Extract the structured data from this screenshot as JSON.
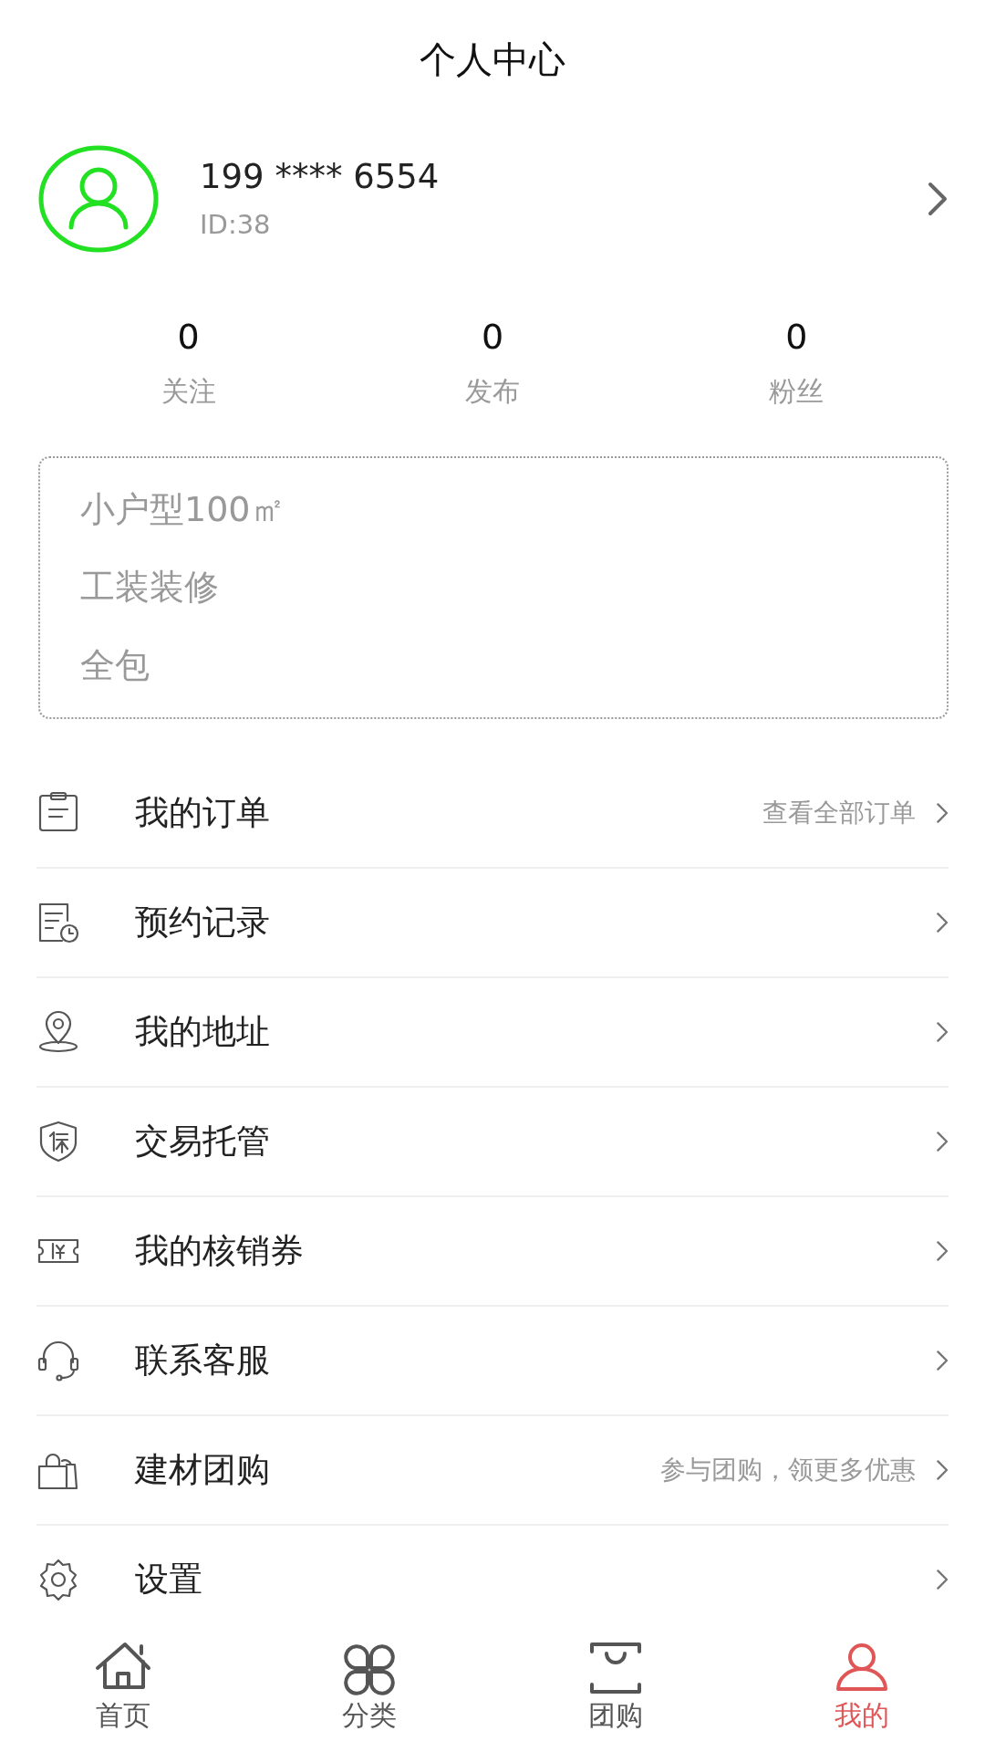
{
  "header": {
    "title": "个人中心"
  },
  "profile": {
    "phone": "199 **** 6554",
    "id": "ID:38"
  },
  "stats": [
    {
      "value": "0",
      "label": "关注"
    },
    {
      "value": "0",
      "label": "发布"
    },
    {
      "value": "0",
      "label": "粉丝"
    }
  ],
  "tags": [
    "小户型100㎡",
    "工装装修",
    "全包"
  ],
  "menu": [
    {
      "kind": "order",
      "label": "我的订单",
      "hint": "查看全部订单"
    },
    {
      "kind": "record",
      "label": "预约记录"
    },
    {
      "kind": "address",
      "label": "我的地址"
    },
    {
      "kind": "escrow",
      "label": "交易托管"
    },
    {
      "kind": "coupon",
      "label": "我的核销券"
    },
    {
      "kind": "service",
      "label": "联系客服"
    },
    {
      "kind": "groupbuy",
      "label": "建材团购",
      "hint": "参与团购，领更多优惠"
    },
    {
      "kind": "settings",
      "label": "设置"
    }
  ],
  "tab_bar": [
    {
      "kind": "home",
      "label": "首页",
      "selected": false
    },
    {
      "kind": "category",
      "label": "分类",
      "selected": false
    },
    {
      "kind": "group",
      "label": "团购",
      "selected": false
    },
    {
      "kind": "mine",
      "label": "我的",
      "selected": true
    }
  ]
}
